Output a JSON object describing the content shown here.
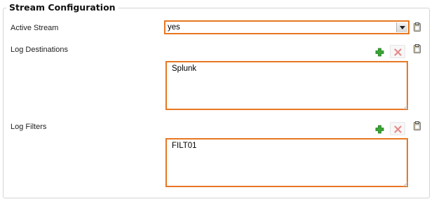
{
  "section": {
    "title": "Stream Configuration"
  },
  "active_stream": {
    "label": "Active Stream",
    "value": "yes"
  },
  "log_destinations": {
    "label": "Log Destinations",
    "items": [
      "Splunk"
    ]
  },
  "log_filters": {
    "label": "Log Filters",
    "items": [
      "FILT01"
    ]
  },
  "icons": {
    "add": "add-icon",
    "remove": "remove-icon",
    "clipboard": "clipboard-icon",
    "dropdown": "chevron-down-icon"
  },
  "colors": {
    "accent_border": "#e87722",
    "add_green": "#3aa535",
    "remove_red": "#e68a8a"
  }
}
